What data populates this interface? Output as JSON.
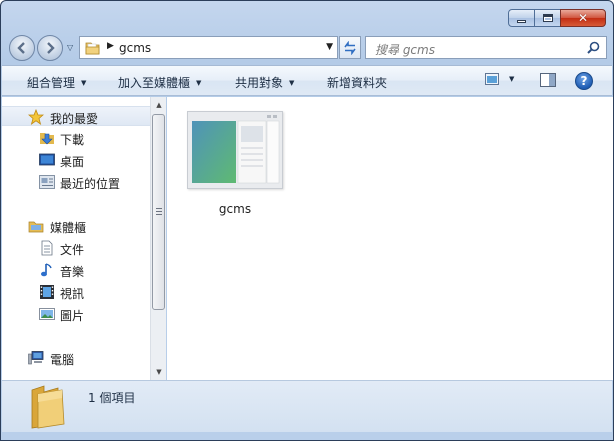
{
  "window": {
    "caption_buttons": {
      "minimize": "minimize",
      "maximize": "maximize",
      "close": "✕"
    }
  },
  "address_bar": {
    "path": "gcms",
    "search_placeholder": "搜尋 gcms"
  },
  "toolbar": {
    "organize": "組合管理",
    "add_to_library": "加入至媒體櫃",
    "share_with": "共用對象",
    "new_folder": "新增資料夾",
    "help": "?"
  },
  "nav_pane": {
    "favorites": {
      "label": "我的最愛",
      "items": [
        {
          "label": "下載",
          "icon": "download-folder-icon"
        },
        {
          "label": "桌面",
          "icon": "desktop-icon"
        },
        {
          "label": "最近的位置",
          "icon": "recent-places-icon"
        }
      ]
    },
    "libraries": {
      "label": "媒體櫃",
      "items": [
        {
          "label": "文件",
          "icon": "documents-icon"
        },
        {
          "label": "音樂",
          "icon": "music-icon"
        },
        {
          "label": "視訊",
          "icon": "video-icon"
        },
        {
          "label": "圖片",
          "icon": "pictures-icon"
        }
      ]
    },
    "computer": {
      "label": "電腦"
    }
  },
  "content": {
    "files": [
      {
        "name": "gcms"
      }
    ]
  },
  "details_pane": {
    "status": "1 個項目"
  }
}
